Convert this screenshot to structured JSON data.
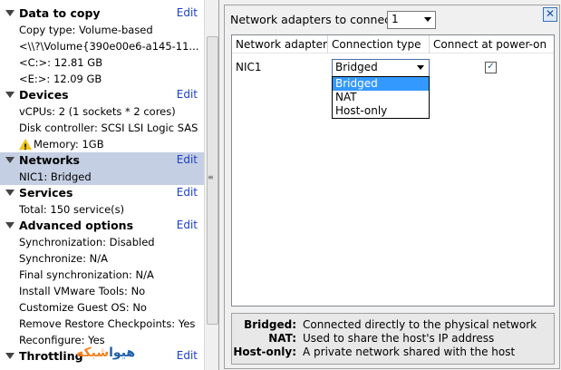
{
  "sidebar": {
    "edit_label": "Edit",
    "sections": [
      {
        "title": "Data to copy",
        "items": [
          "Copy type: Volume-based",
          "<\\\\?\\Volume{390e00e6-a145-11...",
          "<C:>: 12.81 GB",
          "<E:>: 12.09 GB"
        ]
      },
      {
        "title": "Devices",
        "items": [
          "vCPUs: 2 (1 sockets * 2 cores)",
          "Disk controller: SCSI LSI Logic SAS",
          "Memory: 1GB"
        ]
      },
      {
        "title": "Networks",
        "items": [
          "NIC1: Bridged"
        ]
      },
      {
        "title": "Services",
        "items": [
          "Total: 150 service(s)"
        ]
      },
      {
        "title": "Advanced options",
        "items": [
          "Synchronization: Disabled",
          "Synchronize: N/A",
          "Final synchronization: N/A",
          "Install VMware Tools: No",
          "Customize Guest OS: No",
          "Remove Restore Checkpoints: Yes",
          "Reconfigure: Yes"
        ]
      },
      {
        "title": "Throttling",
        "items": []
      }
    ],
    "watermark": {
      "part1": "هیوا",
      "part2": "شبکه"
    }
  },
  "panel": {
    "adapters_label": "Network adapters to connect",
    "adapters_value": "1",
    "columns": [
      "Network adapter",
      "Connection type",
      "Connect at power-on"
    ],
    "row": {
      "adapter": "NIC1",
      "connection": "Bridged",
      "power_on": "✓"
    },
    "dropdown_options": [
      "Bridged",
      "NAT",
      "Host-only"
    ],
    "close": "✕",
    "legend": [
      {
        "key": "Bridged:",
        "value": "Connected directly to the physical network"
      },
      {
        "key": "NAT:",
        "value": "Used to share the host's IP address"
      },
      {
        "key": "Host-only:",
        "value": "A private network shared with the host"
      }
    ]
  }
}
